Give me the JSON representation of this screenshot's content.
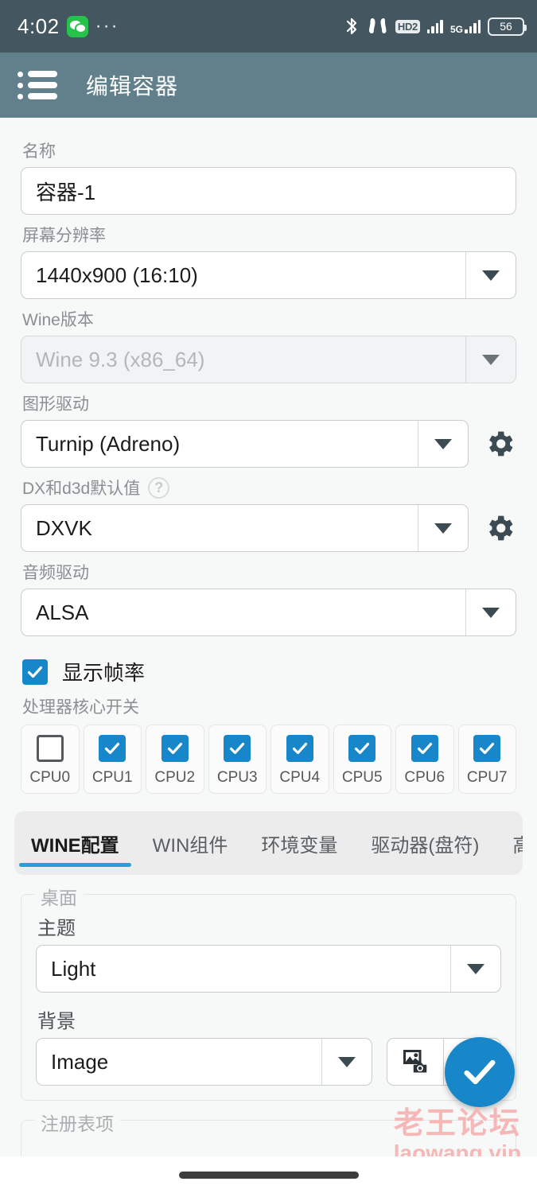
{
  "status_bar": {
    "time": "4:02",
    "wechat_icon": "wechat-icon",
    "overflow_dots": "···",
    "bluetooth_icon": "bluetooth-icon",
    "earbuds_icon": "earbuds-icon",
    "hd_label": "HD2",
    "network_label": "5G",
    "battery_level": "56"
  },
  "app_bar": {
    "menu_icon": "list-menu-icon",
    "title": "编辑容器"
  },
  "form": {
    "name": {
      "label": "名称",
      "value": "容器-1"
    },
    "resolution": {
      "label": "屏幕分辨率",
      "value": "1440x900 (16:10)"
    },
    "wine_version": {
      "label": "Wine版本",
      "value": "Wine 9.3 (x86_64)",
      "disabled": true
    },
    "graphics_driver": {
      "label": "图形驱动",
      "value": "Turnip (Adreno)",
      "settings_icon": "gear-icon"
    },
    "dx_d3d": {
      "label": "DX和d3d默认值",
      "help_icon": "help-icon",
      "value": "DXVK",
      "settings_icon": "gear-icon"
    },
    "audio_driver": {
      "label": "音频驱动",
      "value": "ALSA"
    },
    "show_fps": {
      "label": "显示帧率",
      "checked": true
    },
    "cpu_section": {
      "label": "处理器核心开关",
      "cores": [
        {
          "label": "CPU0",
          "checked": false
        },
        {
          "label": "CPU1",
          "checked": true
        },
        {
          "label": "CPU2",
          "checked": true
        },
        {
          "label": "CPU3",
          "checked": true
        },
        {
          "label": "CPU4",
          "checked": true
        },
        {
          "label": "CPU5",
          "checked": true
        },
        {
          "label": "CPU6",
          "checked": true
        },
        {
          "label": "CPU7",
          "checked": true
        }
      ]
    }
  },
  "tabs": [
    {
      "label": "WINE配置",
      "active": true
    },
    {
      "label": "WIN组件",
      "active": false
    },
    {
      "label": "环境变量",
      "active": false
    },
    {
      "label": "驱动器(盘符)",
      "active": false
    },
    {
      "label": "高",
      "active": false
    }
  ],
  "desktop_section": {
    "legend": "桌面",
    "theme": {
      "label": "主题",
      "value": "Light"
    },
    "background": {
      "label": "背景",
      "value": "Image",
      "pick_icon": "image-camera-icon"
    }
  },
  "registry_section": {
    "legend": "注册表项"
  },
  "fab": {
    "icon": "check-icon",
    "color": "#1787c9"
  },
  "watermark": {
    "line1": "老王论坛",
    "line2": "laowang.vip"
  },
  "nav_bar": {
    "handle": "home-gesture-handle"
  },
  "colors": {
    "status_bar": "#44565f",
    "app_bar": "#62808c",
    "accent": "#1787c9",
    "tab_indicator": "#2a9fd6",
    "page_bg": "#f7f8f8"
  }
}
